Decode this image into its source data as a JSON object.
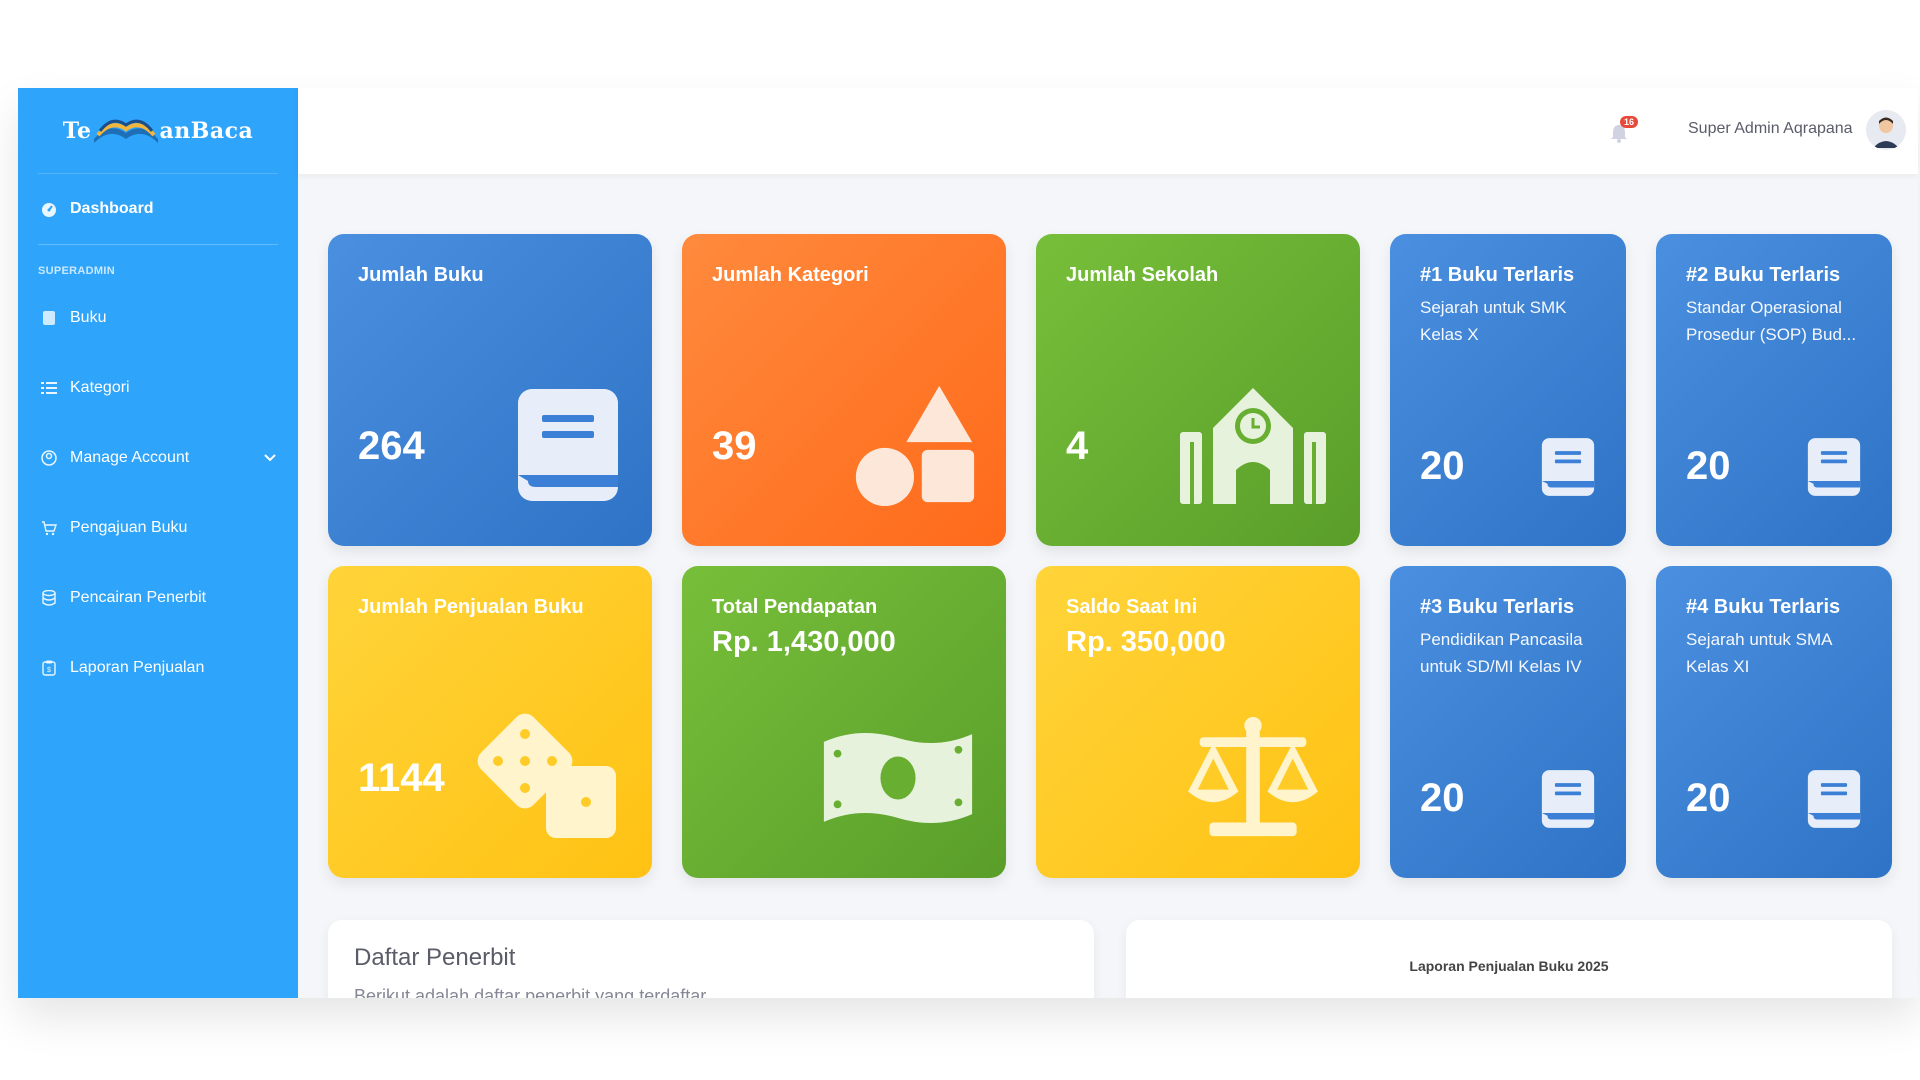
{
  "brand": {
    "name_left": "Te",
    "name_right": "anBaca",
    "logo_icon": "open-book-icon"
  },
  "sidebar": {
    "dashboard": "Dashboard",
    "heading": "SUPERADMIN",
    "items": [
      {
        "label": "Buku",
        "icon": "book-icon"
      },
      {
        "label": "Kategori",
        "icon": "list-icon"
      },
      {
        "label": "Manage Account",
        "icon": "user-circle-icon"
      },
      {
        "label": "Pengajuan Buku",
        "icon": "cart-icon"
      },
      {
        "label": "Pencairan Penerbit",
        "icon": "database-icon"
      },
      {
        "label": "Laporan Penjualan",
        "icon": "clipboard-icon"
      }
    ]
  },
  "topbar": {
    "notification_count": "16",
    "user_name": "Super Admin Aqrapana"
  },
  "cards": {
    "jumlah_buku": {
      "title": "Jumlah Buku",
      "value": "264"
    },
    "jumlah_kategori": {
      "title": "Jumlah Kategori",
      "value": "39"
    },
    "jumlah_sekolah": {
      "title": "Jumlah Sekolah",
      "value": "4"
    },
    "terlaris1": {
      "title": "#1 Buku Terlaris",
      "subtitle": "Sejarah untuk SMK Kelas X",
      "value": "20"
    },
    "terlaris2": {
      "title": "#2 Buku Terlaris",
      "subtitle": "Standar Operasional Prosedur (SOP) Bud...",
      "value": "20"
    },
    "penjualan": {
      "title": "Jumlah Penjualan Buku",
      "value": "1144"
    },
    "pendapatan": {
      "title": "Total Pendapatan",
      "amount": "Rp. 1,430,000"
    },
    "saldo": {
      "title": "Saldo Saat Ini",
      "amount": "Rp. 350,000"
    },
    "terlaris3": {
      "title": "#3 Buku Terlaris",
      "subtitle": "Pendidikan Pancasila untuk SD/MI Kelas IV",
      "value": "20"
    },
    "terlaris4": {
      "title": "#4 Buku Terlaris",
      "subtitle": "Sejarah untuk SMA Kelas XI",
      "value": "20"
    }
  },
  "panels": {
    "penerbit": {
      "title": "Daftar Penerbit",
      "subtitle": "Berikut adalah daftar penerbit yang terdaftar"
    },
    "laporan": {
      "title": "Laporan Penjualan Buku 2025"
    }
  },
  "colors": {
    "sidebar": "#2ea4fb",
    "blue": "#3b80d6",
    "orange": "#ff7a2a",
    "green": "#68ae31",
    "yellow": "#ffcb26"
  }
}
